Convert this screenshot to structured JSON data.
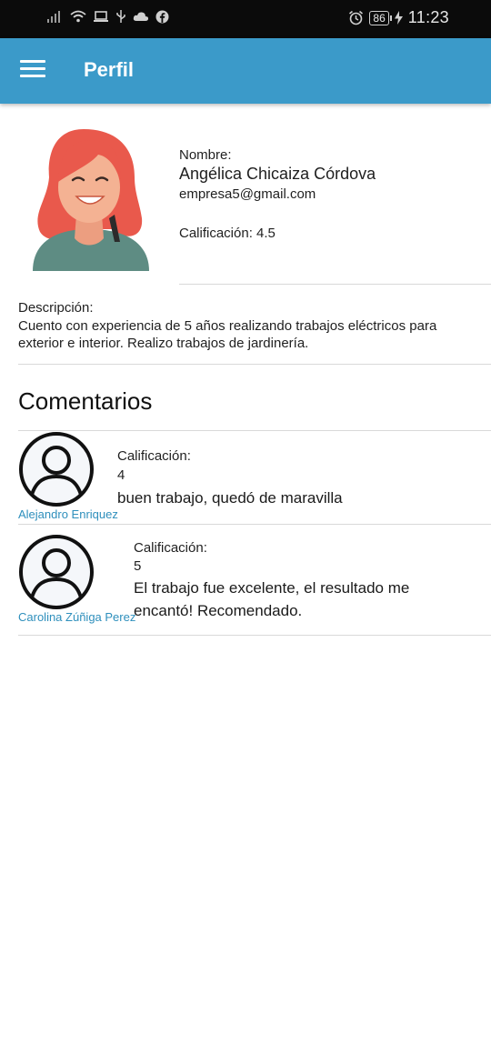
{
  "status_bar": {
    "time": "11:23",
    "battery": "86",
    "icons": [
      "signal-icon",
      "wifi-icon",
      "laptop-icon",
      "usb-icon",
      "cloud-icon",
      "facebook-icon",
      "alarm-icon",
      "battery-icon",
      "charging-icon"
    ]
  },
  "app_bar": {
    "title": "Perfil",
    "menu_icon": "menu-icon"
  },
  "profile": {
    "name_label": "Nombre:",
    "name": "Angélica Chicaiza Córdova",
    "email": "empresa5@gmail.com",
    "rating_text": "Calificación: 4.5",
    "description_label": "Descripción:",
    "description": "Cuento con experiencia de 5 años realizando trabajos eléctricos para exterior e interior. Realizo trabajos de jardinería."
  },
  "comments": {
    "heading": "Comentarios",
    "items": [
      {
        "author": "Alejandro Enriquez",
        "rating_label": "Calificación:",
        "rating": "4",
        "text": "buen trabajo, quedó de maravilla"
      },
      {
        "author": "Carolina Zúñiga Perez",
        "rating_label": "Calificación:",
        "rating": "5",
        "text": "El trabajo fue excelente, el resultado me encantó! Recomendado."
      }
    ]
  },
  "colors": {
    "app_bar": "#3b9ac9",
    "author_link": "#2e8fbc",
    "status_bar": "#0b0b0b"
  }
}
